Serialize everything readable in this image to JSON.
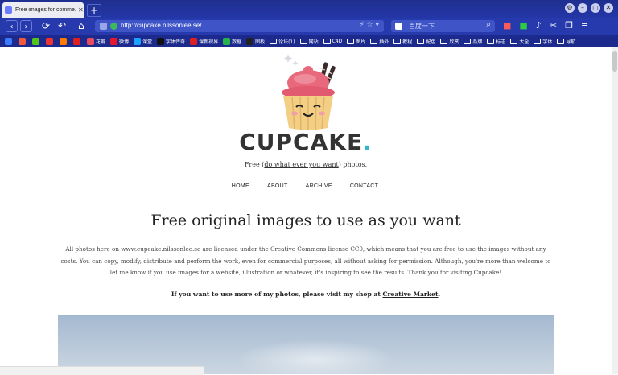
{
  "browser": {
    "tab_title": "Free images for comme...",
    "tab_close": "✕",
    "new_tab": "+",
    "url": "http://cupcake.nilssonlee.se/",
    "search_placeholder": "百度一下",
    "window_buttons": [
      "⚙",
      "–",
      "□",
      "✕"
    ],
    "bookmarks": [
      {
        "label": "",
        "color": "#3b7bff"
      },
      {
        "label": "",
        "color": "#f05a3a"
      },
      {
        "label": "",
        "color": "#52c41a"
      },
      {
        "label": "",
        "color": "#e33"
      },
      {
        "label": "",
        "color": "#ff7a00"
      },
      {
        "label": "",
        "color": "#e02020"
      },
      {
        "label": "花瓣",
        "color": "#e94b5f"
      },
      {
        "label": "微博",
        "color": "#e6162d"
      },
      {
        "label": "课堂",
        "color": "#1aa3ff"
      },
      {
        "label": "字体传奇",
        "color": "#111"
      },
      {
        "label": "课新视界",
        "color": "#e02020"
      },
      {
        "label": "数据",
        "color": "#27b34b"
      },
      {
        "label": "图板",
        "color": "#222"
      },
      {
        "label": "论坛(1)",
        "folder": true
      },
      {
        "label": "网站",
        "folder": true
      },
      {
        "label": "C4D",
        "folder": true
      },
      {
        "label": "图片",
        "folder": true
      },
      {
        "label": "插外",
        "folder": true
      },
      {
        "label": "教程",
        "folder": true
      },
      {
        "label": "配色",
        "folder": true
      },
      {
        "label": "欣赏",
        "folder": true
      },
      {
        "label": "品牌",
        "folder": true
      },
      {
        "label": "标志",
        "folder": true
      },
      {
        "label": "大全",
        "folder": true
      },
      {
        "label": "字体",
        "folder": true
      },
      {
        "label": "导航",
        "folder": true
      }
    ]
  },
  "site": {
    "brand": "CUPCAKE",
    "brand_dot": ".",
    "tagline_before": "Free (",
    "tagline_link": "do what ever you want",
    "tagline_after": ") photos.",
    "nav": [
      "HOME",
      "ABOUT",
      "ARCHIVE",
      "CONTACT"
    ],
    "headline": "Free original images to use as you want",
    "paragraph": "All photos here on www.cupcake.nilssonlee.se are licensed under the Creative Commons license CC0, which means that you are free to use the images without any costs. You can copy, modify, distribute and perform the work, even for commercial purposes, all without asking for permission. Although, you're more than welcome to let me know if you use images for a website, illustration or whatever, it's inspiring to see the results. Thank you for visiting Cupcake!",
    "shop_before": "If you want to use more of my photos, please visit my shop at ",
    "shop_link": "Creative Market",
    "shop_after": "."
  },
  "colors": {
    "chrome": "#2336a6",
    "accent_dot": "#36b7c9",
    "frosting": "#e8697c",
    "cup": "#f3cf86"
  }
}
